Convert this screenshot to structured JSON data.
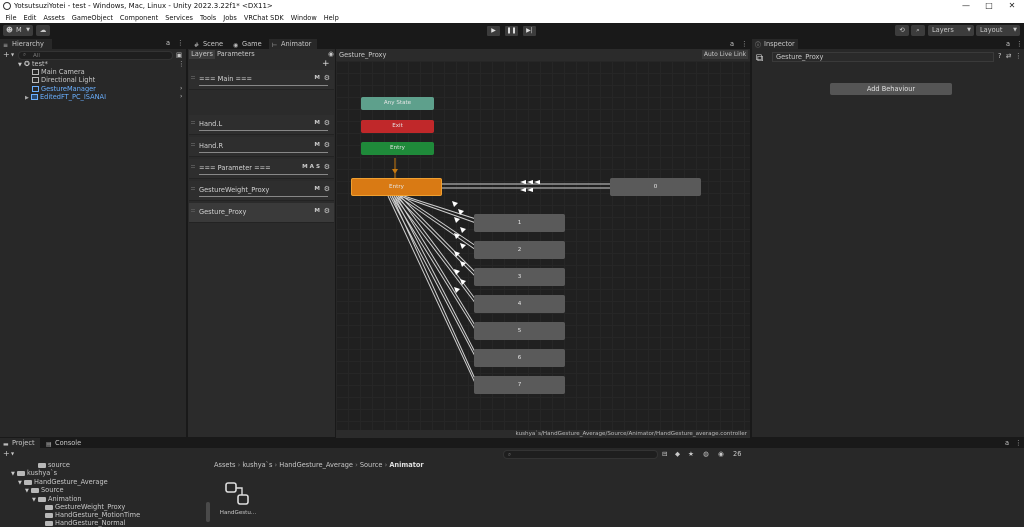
{
  "window": {
    "title": "YotsutsuziYotei - test - Windows, Mac, Linux - Unity 2022.3.22f1* <DX11>"
  },
  "menu": [
    "File",
    "Edit",
    "Assets",
    "GameObject",
    "Component",
    "Services",
    "Tools",
    "Jobs",
    "VRChat SDK",
    "Window",
    "Help"
  ],
  "toolbar": {
    "account": "M",
    "layers_label": "Layers",
    "layout_label": "Layout"
  },
  "hierarchy": {
    "tab": "Hierarchy",
    "search_placeholder": "All",
    "scene": "test*",
    "items": [
      "Main Camera",
      "Directional Light",
      "GestureManager",
      "EditedFT_PC_ISANAI"
    ]
  },
  "center_tabs": {
    "scene": "Scene",
    "game": "Game",
    "animator": "Animator"
  },
  "animator": {
    "subtabs": {
      "layers": "Layers",
      "parameters": "Parameters"
    },
    "breadcrumb": "Gesture_Proxy",
    "auto_live_link": "Auto Live Link",
    "path": "kushya`s/HandGesture_Average/Source/Animator/HandGesture_average.controller",
    "layers": [
      {
        "name": "=== Main ===",
        "flags": "M"
      },
      {
        "name": "Hand.L",
        "flags": "M"
      },
      {
        "name": "Hand.R",
        "flags": "M"
      },
      {
        "name": "=== Parameter ===",
        "flags": "M A S"
      },
      {
        "name": "GestureWeight_Proxy",
        "flags": "M"
      },
      {
        "name": "Gesture_Proxy",
        "flags": "M"
      }
    ],
    "nodes": {
      "any_state": "Any State",
      "exit": "Exit",
      "entry": "Entry",
      "entry_state": "Entry",
      "states": [
        "0",
        "1",
        "2",
        "3",
        "4",
        "5",
        "6",
        "7"
      ]
    }
  },
  "inspector": {
    "tab": "Inspector",
    "object_name": "Gesture_Proxy",
    "add_behaviour": "Add Behaviour"
  },
  "project": {
    "tabs": {
      "project": "Project",
      "console": "Console"
    },
    "tree": [
      "source",
      "kushya`s",
      "HandGesture_Average",
      "Source",
      "Animation",
      "GestureWeight_Proxy",
      "HandGesture_MotionTime",
      "HandGesture_Normal"
    ],
    "breadcrumb": [
      "Assets",
      "kushya`s",
      "HandGesture_Average",
      "Source",
      "Animator"
    ],
    "asset_label": "HandGestu...",
    "count": "26"
  },
  "colors": {
    "any_state": "#5ea08c",
    "exit": "#c0282a",
    "entry": "#1f8a3a",
    "selected_state": "#d97a14",
    "state": "#5a5a5a",
    "accent_blue": "#6ab0ff"
  }
}
